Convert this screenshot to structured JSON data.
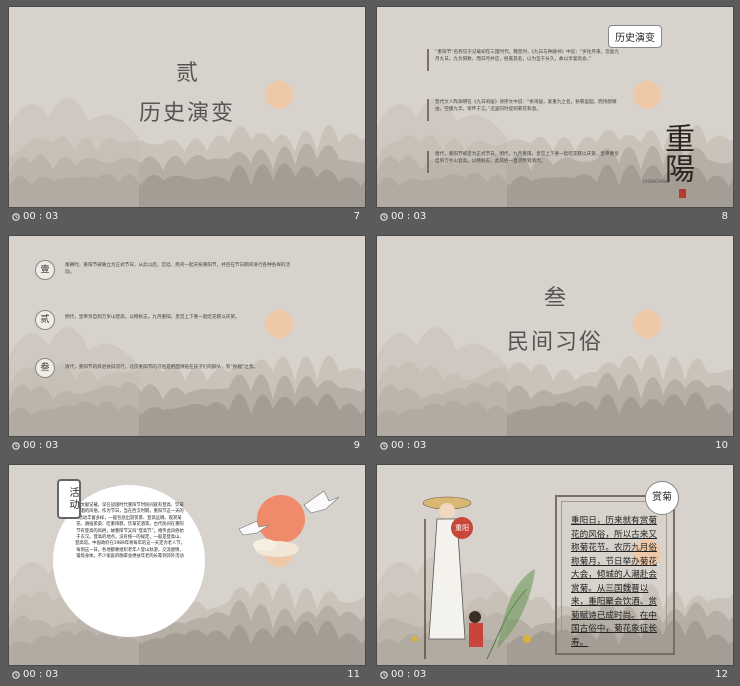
{
  "slides": [
    {
      "number": "7",
      "time": "00 : 03",
      "numeral": "贰",
      "title": "历史演变"
    },
    {
      "number": "8",
      "time": "00 : 03",
      "tag": "历史演变",
      "paragraphs": [
        "“重阳节”名称见于记载却在三国时代。魏晋时，《九日与钟繇书》中说：“岁往月来，忽复九月九日。九为阳数，而日月并应，俗嘉其名，以为宜于长久，故以享宴高会。”",
        "晋代文人陶渊明在《九日闲居》诗序文中说：“余闲居，爱重九之名。秋菊盈园，而持醪靡由，空服九华，寄怀于言。”这里同时提到菊花和酒。",
        "唐代，重阳节被定为正式节日。明代，九月重阳，皇宫上下要一起吃花糕以庆贺，皇帝要亲自到万岁山登高，以畅秋志，此风俗一直流传到清代。"
      ],
      "logo_text": "重陽",
      "logo_sub": "CHONGYANG"
    },
    {
      "number": "9",
      "time": "00 : 03",
      "items": [
        {
          "badge": "壹",
          "text": "秦朝时，重阳节被确立为正式节日，从此以后，宫廷、民间一起庆祝重阳节，并且在节日期间进行各种各样的活动。"
        },
        {
          "badge": "贰",
          "text": "明代，皇帝亲自到万岁山登高，以畅秋志。九月重阳，皇宫上下要一起吃花糕以庆贺。"
        },
        {
          "badge": "叁",
          "text": "清代，重阳节的风俗依旧流行，北京重阳节的习俗是把面饼贴在孩子们的额头，有“祝福”之意。"
        }
      ]
    },
    {
      "number": "10",
      "time": "00 : 03",
      "numeral": "叁",
      "title": "民间习俗"
    },
    {
      "number": "11",
      "time": "00 : 03",
      "tag": "活动",
      "text": "据文献记载，早在战国时代重阳节时民间就有登高、饮菊花酒的风俗。作为节日，当在西汉时期。重阳节这一天的活动丰富多样，一般包括出游赏景、登高远眺、观赏菊花、遍插茱萸、吃重阳糕、饮菊花酒等。古代民间在重阳节有登高的风俗，故重阳节又叫“登高节”。相传此风俗始于东汉。登高的地点，没有统一的规定，一般是登高山、登高塔。中国政府在1989年将每年的这一天定为老人节。每到这一日，各地都要组织老年人登山秋游，交流感情，锻炼身体。不少家庭的晚辈会搀扶年老的长辈到郊外活动"
    },
    {
      "number": "12",
      "time": "00 : 03",
      "tag": "赏菊",
      "figure_label": "重阳",
      "text": "重阳日，历来就有赏菊花的风俗，所以古来又称菊花节。农历九月俗称菊月，节日举办菊花大会，倾城的人潮赴会赏菊。从三国魏晋以来，重阳聚会饮酒、赏菊赋诗已成时尚。在中国古俗中，菊花象征长寿。"
    }
  ],
  "colors": {
    "slide_bg": "#d7d2cb",
    "ink": "#555555",
    "sun": "#f0b98f",
    "accent_red": "#c8473a"
  }
}
